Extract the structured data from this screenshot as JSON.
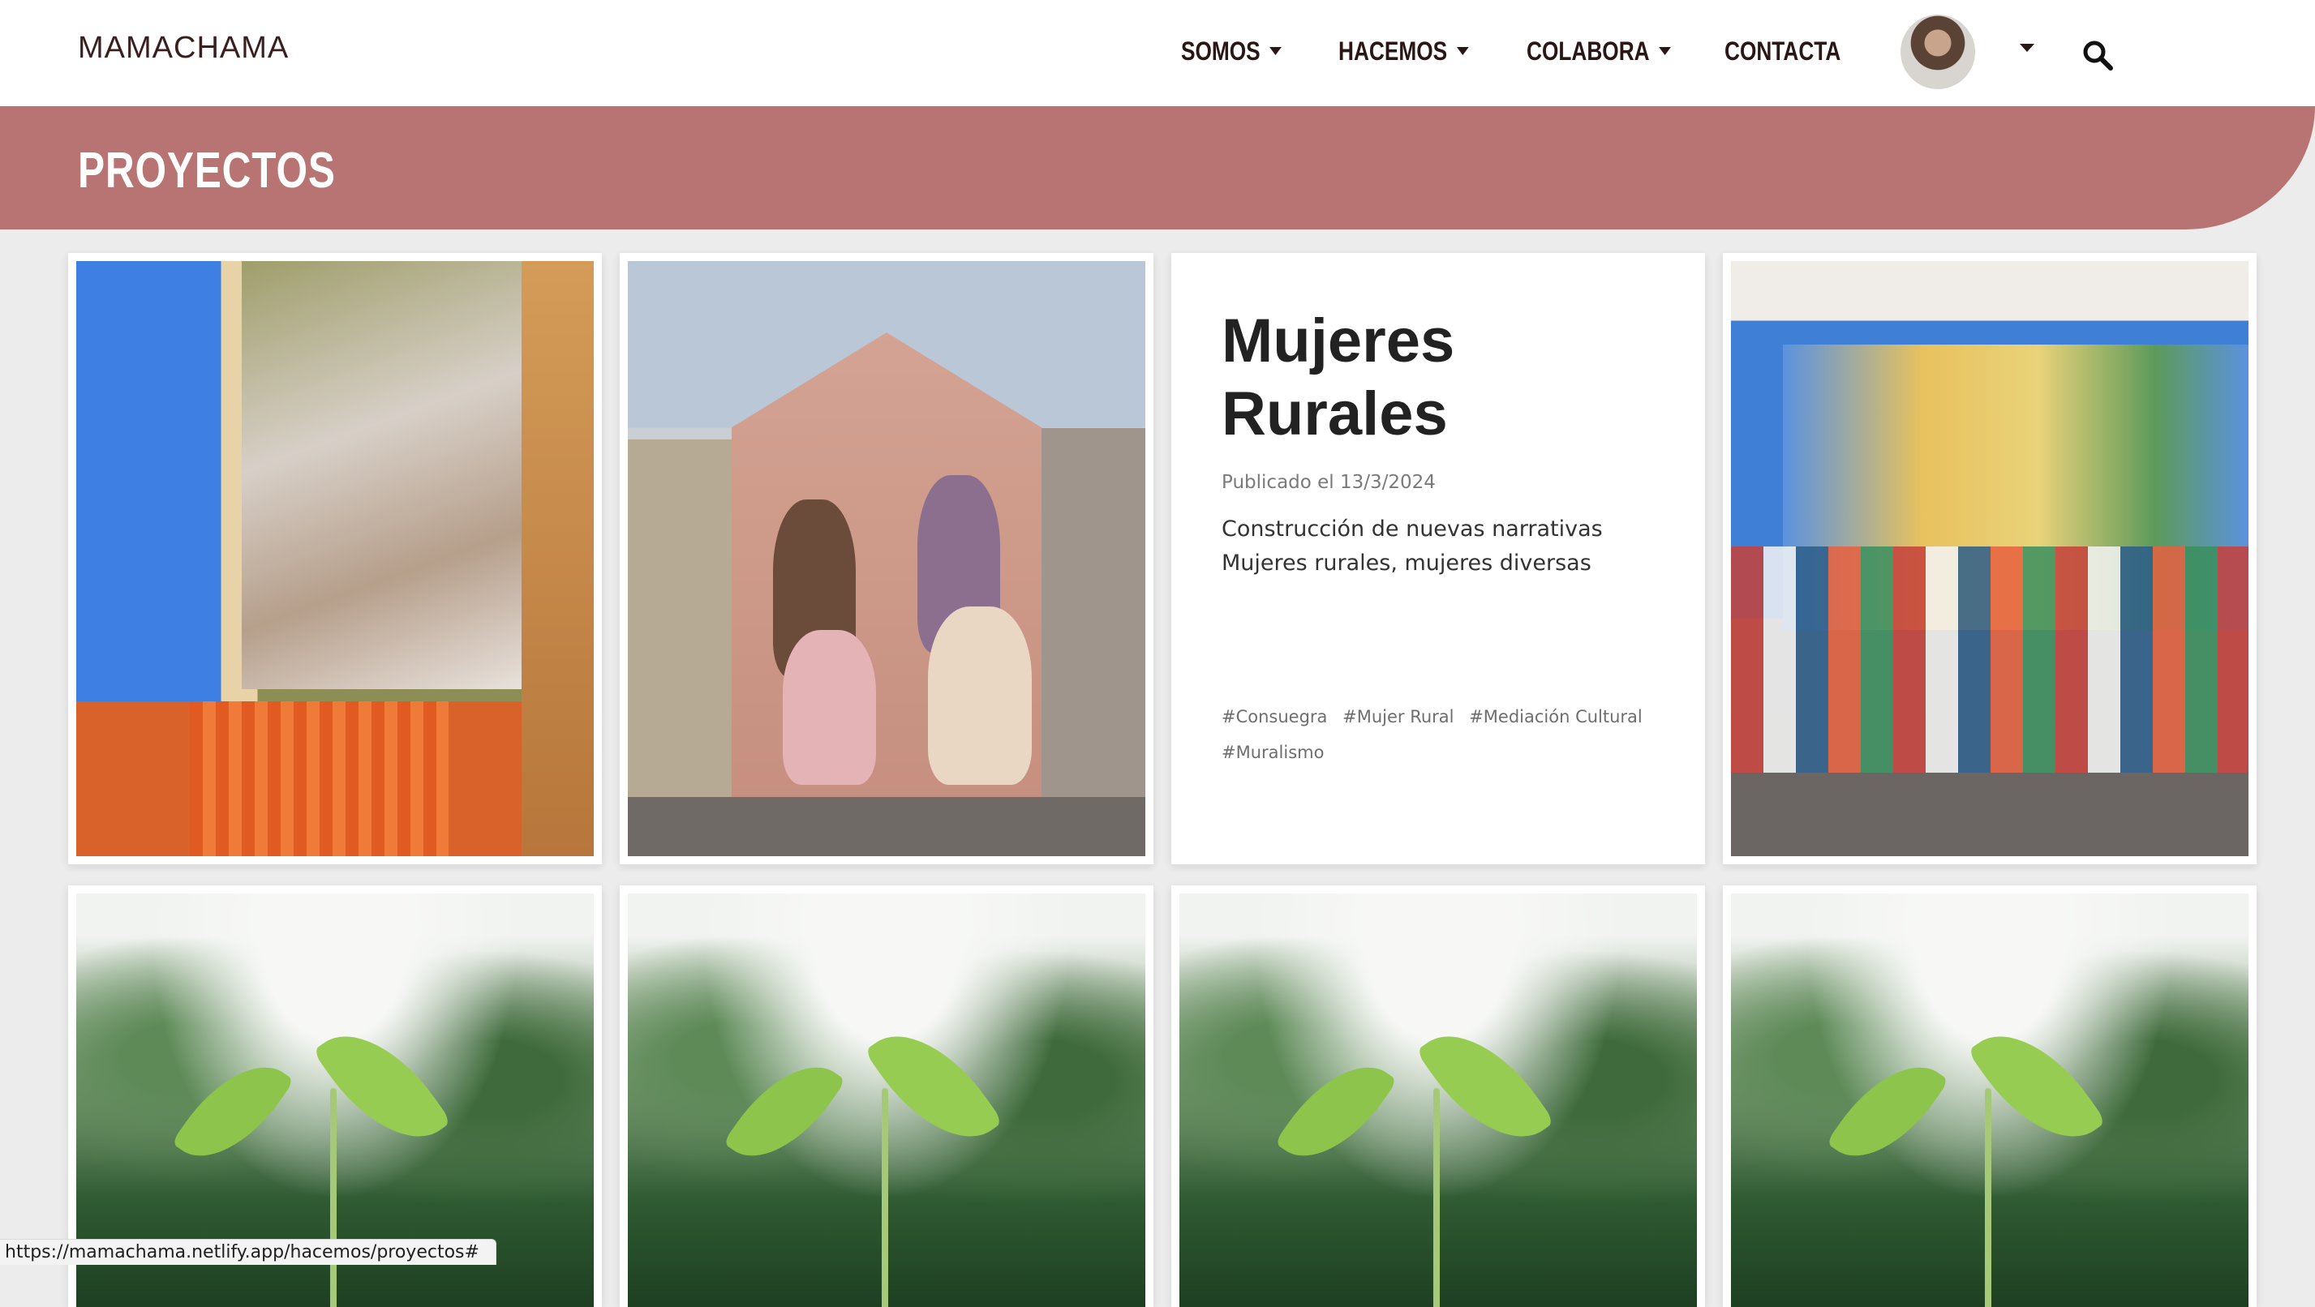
{
  "navbar": {
    "brand": "MAMACHAMA",
    "items": [
      {
        "label": "SOMOS",
        "dropdown": true
      },
      {
        "label": "HACEMOS",
        "dropdown": true
      },
      {
        "label": "COLABORA",
        "dropdown": true
      },
      {
        "label": "CONTACTA",
        "dropdown": false
      }
    ],
    "user_menu_dropdown": true,
    "search_icon": "search-icon"
  },
  "hero": {
    "title": "PROYECTOS",
    "color": "#b87373"
  },
  "project_card": {
    "title": "Mujeres Rurales",
    "date": "Publicado el 13/3/2024",
    "description_line1": "Construcción de nuevas narrativas",
    "description_line2": "Mujeres rurales, mujeres diversas",
    "tags": [
      "#Consuegra",
      "#Mujer Rural",
      "#Mediación Cultural",
      "#Muralismo"
    ]
  },
  "status_bar": {
    "url": "https://mamachama.netlify.app/hacemos/proyectos#"
  }
}
